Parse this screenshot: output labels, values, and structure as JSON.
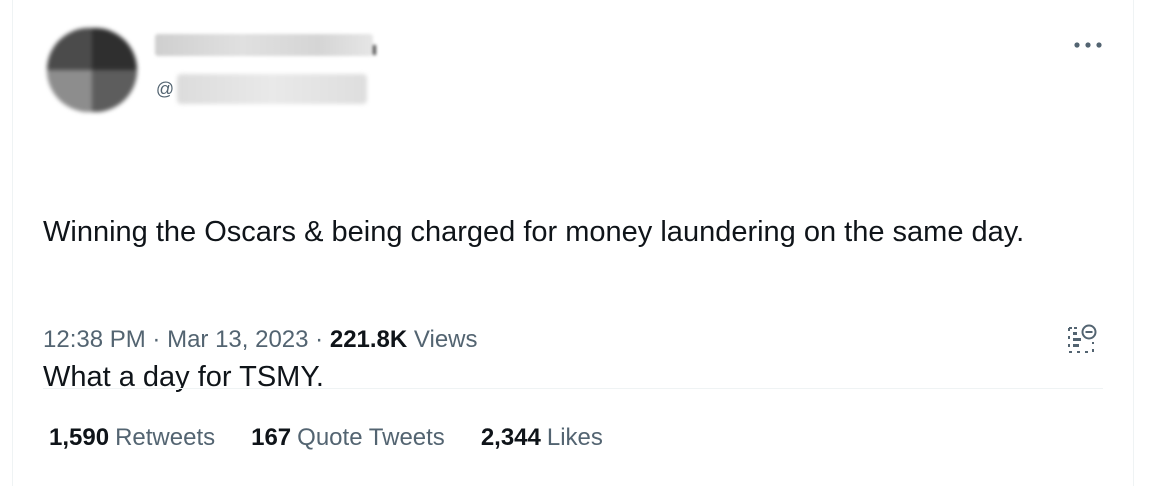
{
  "tweet": {
    "author": {
      "avatar_icon": "avatar-blurred",
      "at_symbol": "@"
    },
    "menu_icon": "more-horizontal-icon",
    "text_line1": "Winning the Oscars & being charged for money laundering on the same day.",
    "text_line2": "What a day for TSMY.",
    "time": "12:38 PM",
    "separator": "·",
    "date": "Mar 13, 2023",
    "views_count": "221.8K",
    "views_label": "Views",
    "analytics_icon": "view-analytics-icon"
  },
  "stats": {
    "retweets_count": "1,590",
    "retweets_label": "Retweets",
    "quotes_count": "167",
    "quotes_label": "Quote Tweets",
    "likes_count": "2,344",
    "likes_label": "Likes"
  },
  "colors": {
    "text_primary": "#0f1419",
    "text_secondary": "#536471",
    "divider": "#eff3f4"
  }
}
